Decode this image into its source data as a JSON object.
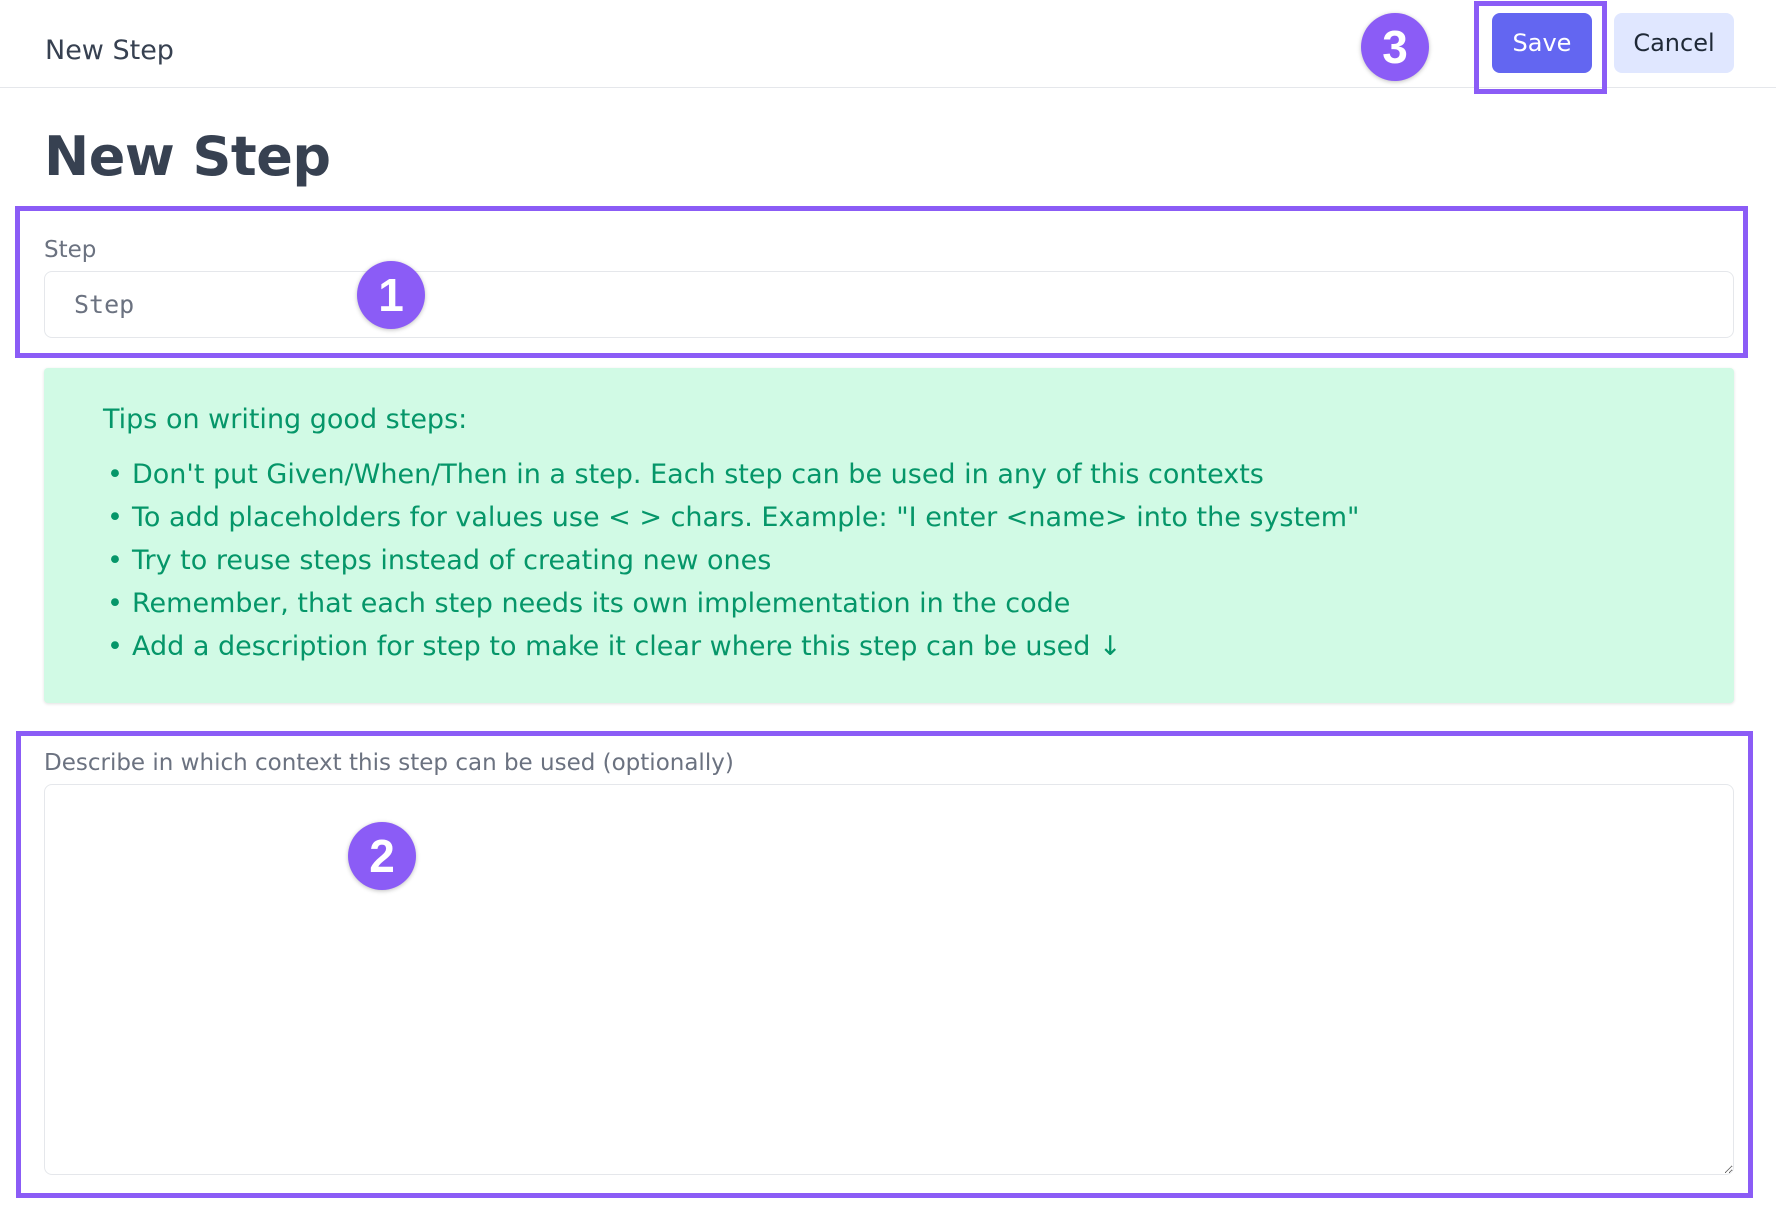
{
  "header": {
    "title": "New Step",
    "save_label": "Save",
    "cancel_label": "Cancel"
  },
  "page": {
    "heading": "New Step"
  },
  "step_field": {
    "label": "Step",
    "value": "",
    "placeholder": "Step"
  },
  "tips": {
    "title": "Tips on writing good steps:",
    "items": [
      "Don't put Given/When/Then in a step. Each step can be used in any of this contexts",
      "To add placeholders for values use < > chars. Example: \"I enter <name> into the system\"",
      "Try to reuse steps instead of creating new ones",
      "Remember, that each step needs its own implementation in the code",
      "Add a description for step to make it clear where this step can be used ↓"
    ]
  },
  "description_field": {
    "label": "Describe in which context this step can be used (optionally)",
    "value": ""
  },
  "annotations": {
    "markers": [
      "1",
      "2",
      "3"
    ],
    "highlight_color": "#8b5cf6"
  },
  "colors": {
    "primary_button": "#6366f1",
    "secondary_button": "#e0e7ff",
    "tips_background": "#d1fae5",
    "tips_text": "#059669"
  }
}
